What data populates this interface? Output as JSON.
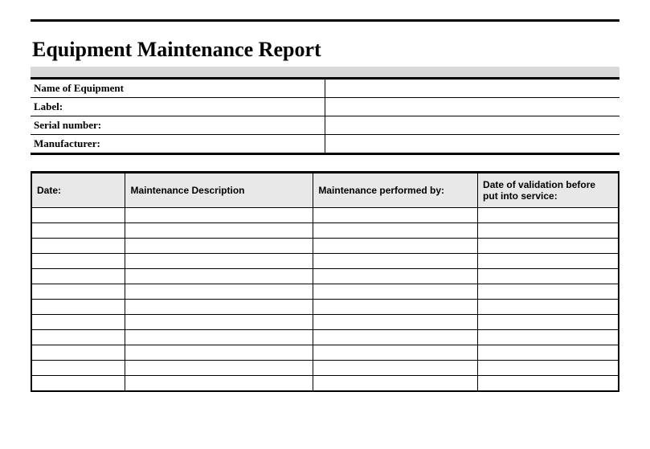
{
  "title": "Equipment Maintenance Report",
  "info": {
    "nameLabel": "Name of Equipment",
    "nameValue": "",
    "labelLabel": "Label:",
    "labelValue": "",
    "serialLabel": "Serial number:",
    "serialValue": "",
    "manufacturerLabel": "Manufacturer:",
    "manufacturerValue": ""
  },
  "log": {
    "headers": {
      "date": "Date:",
      "description": "Maintenance Description",
      "performedBy": "Maintenance performed by:",
      "validation": "Date of validation before put into service:"
    },
    "rows": [
      {
        "date": "",
        "description": "",
        "performedBy": "",
        "validation": ""
      },
      {
        "date": "",
        "description": "",
        "performedBy": "",
        "validation": ""
      },
      {
        "date": "",
        "description": "",
        "performedBy": "",
        "validation": ""
      },
      {
        "date": "",
        "description": "",
        "performedBy": "",
        "validation": ""
      },
      {
        "date": "",
        "description": "",
        "performedBy": "",
        "validation": ""
      },
      {
        "date": "",
        "description": "",
        "performedBy": "",
        "validation": ""
      },
      {
        "date": "",
        "description": "",
        "performedBy": "",
        "validation": ""
      },
      {
        "date": "",
        "description": "",
        "performedBy": "",
        "validation": ""
      },
      {
        "date": "",
        "description": "",
        "performedBy": "",
        "validation": ""
      },
      {
        "date": "",
        "description": "",
        "performedBy": "",
        "validation": ""
      },
      {
        "date": "",
        "description": "",
        "performedBy": "",
        "validation": ""
      },
      {
        "date": "",
        "description": "",
        "performedBy": "",
        "validation": ""
      }
    ]
  }
}
